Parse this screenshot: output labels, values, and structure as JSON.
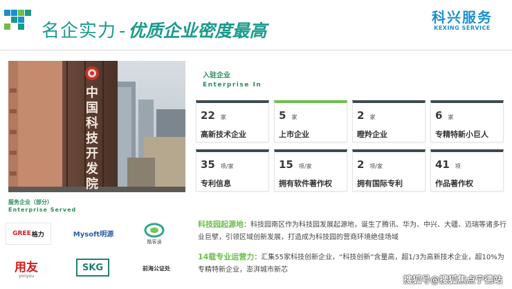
{
  "header": {
    "title_main": "名企实力",
    "title_dash": "-",
    "title_sub": "优质企业密度最高",
    "brand_cn": "科兴服务",
    "brand_en": "KEXING SERVICE",
    "pixel_colors": [
      "#1b8fd0",
      "#6bbf4a",
      "#1a9a8c"
    ]
  },
  "photo": {
    "sign_text": [
      "中",
      "国",
      "科",
      "技",
      "开",
      "发",
      "院"
    ]
  },
  "enterprise": {
    "label_cn": "入驻企业",
    "label_en": "Enterprise In",
    "stats": [
      {
        "num": "22",
        "unit": "家",
        "label": "高新技术企业",
        "highlight": false
      },
      {
        "num": "5",
        "unit": "家",
        "label": "上市企业",
        "highlight": true
      },
      {
        "num": "2",
        "unit": "家",
        "label": "瞪羚企业",
        "highlight": false
      },
      {
        "num": "6",
        "unit": "家",
        "label": "专精特新小巨人",
        "highlight": false
      },
      {
        "num": "35",
        "unit": "项/家",
        "label": "专利信息",
        "highlight": false
      },
      {
        "num": "15",
        "unit": "项/家",
        "label": "拥有软件著作权",
        "highlight": false
      },
      {
        "num": "2",
        "unit": "项/家",
        "label": "拥有国际专利",
        "highlight": false
      },
      {
        "num": "41",
        "unit": "项",
        "label": "作品著作权",
        "highlight": false
      }
    ]
  },
  "clients": {
    "label_cn": "服务企业（部分）",
    "label_en": "Enterprise Served",
    "logos": {
      "gree_mark": "GREE",
      "gree_cn": "格力",
      "mysoft": "Mysoft明源",
      "ktong_name": "酷客通",
      "yonyou_cn": "用友",
      "yonyou_en": "yonyou",
      "skg": "SKG",
      "qianhai": "前海公证处"
    }
  },
  "paragraphs": {
    "p1_kw": "科技园起源地",
    "p1_text": "：科技园南区作为科技园发展起源地，诞生了腾讯、华为、中兴、大疆、迈瑞等诸多行业巨擘，引领区域创新发展，打造成为科技园的营商环境绝佳场域",
    "p2_kw": "14载专业运营力",
    "p2_text": "：汇集55家科技创新企业，“科技创新”含量高，超1/3为高新技术企业，超10%为专精特新企业，澎湃城市新芯"
  },
  "watermark": "搜狐号@搜狐焦点宁德站"
}
